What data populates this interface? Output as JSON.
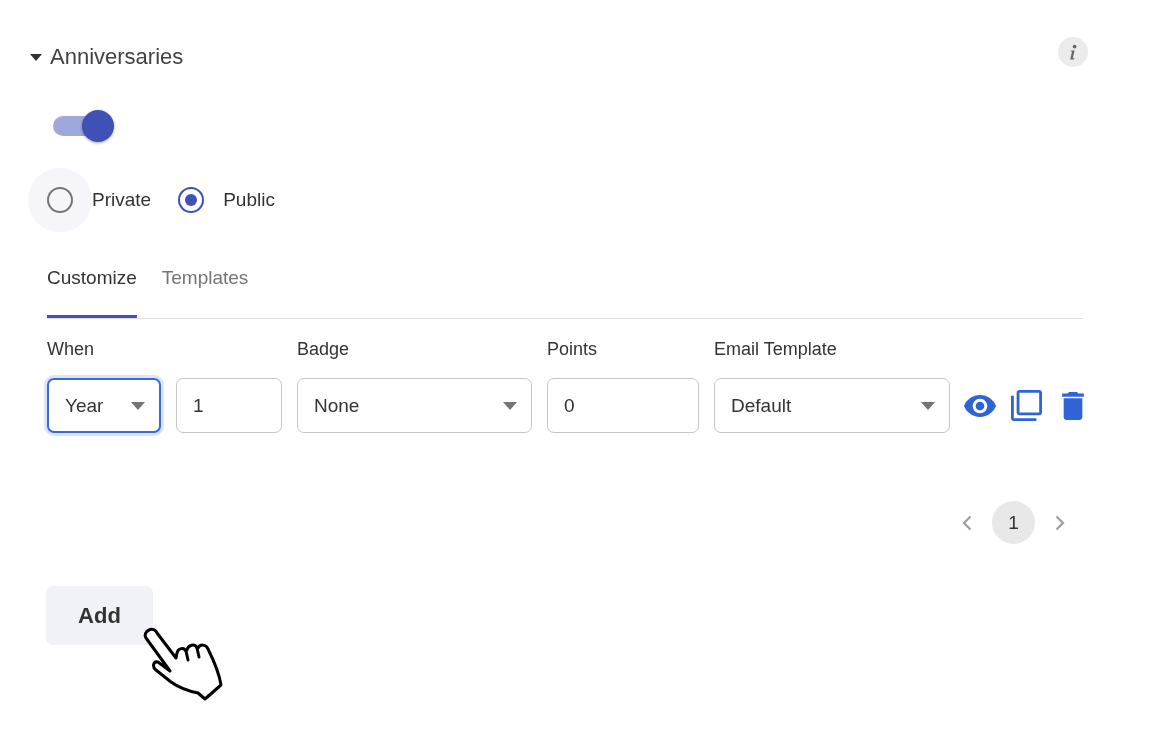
{
  "section": {
    "title": "Anniversaries",
    "expanded": true
  },
  "toggle": {
    "on": true
  },
  "visibility_options": [
    {
      "label": "Private",
      "selected": false,
      "hovered": true
    },
    {
      "label": "Public",
      "selected": true,
      "hovered": false
    }
  ],
  "tabs": [
    {
      "label": "Customize",
      "selected": true
    },
    {
      "label": "Templates",
      "selected": false
    }
  ],
  "rule_columns": [
    {
      "label": "When",
      "fields": [
        {
          "kind": "select",
          "value": "Year",
          "focused": true
        },
        {
          "kind": "input",
          "value": "1",
          "focused": false
        }
      ]
    },
    {
      "label": "Badge",
      "fields": [
        {
          "kind": "select",
          "value": "None",
          "focused": false
        }
      ]
    },
    {
      "label": "Points",
      "fields": [
        {
          "kind": "input",
          "value": "0",
          "focused": false
        }
      ]
    },
    {
      "label": "Email Template",
      "fields": [
        {
          "kind": "select",
          "value": "Default",
          "focused": false
        }
      ]
    }
  ],
  "pagination": {
    "pages": [
      {
        "label": "1",
        "selected": true
      }
    ]
  },
  "add_button": {
    "label": "Add"
  }
}
